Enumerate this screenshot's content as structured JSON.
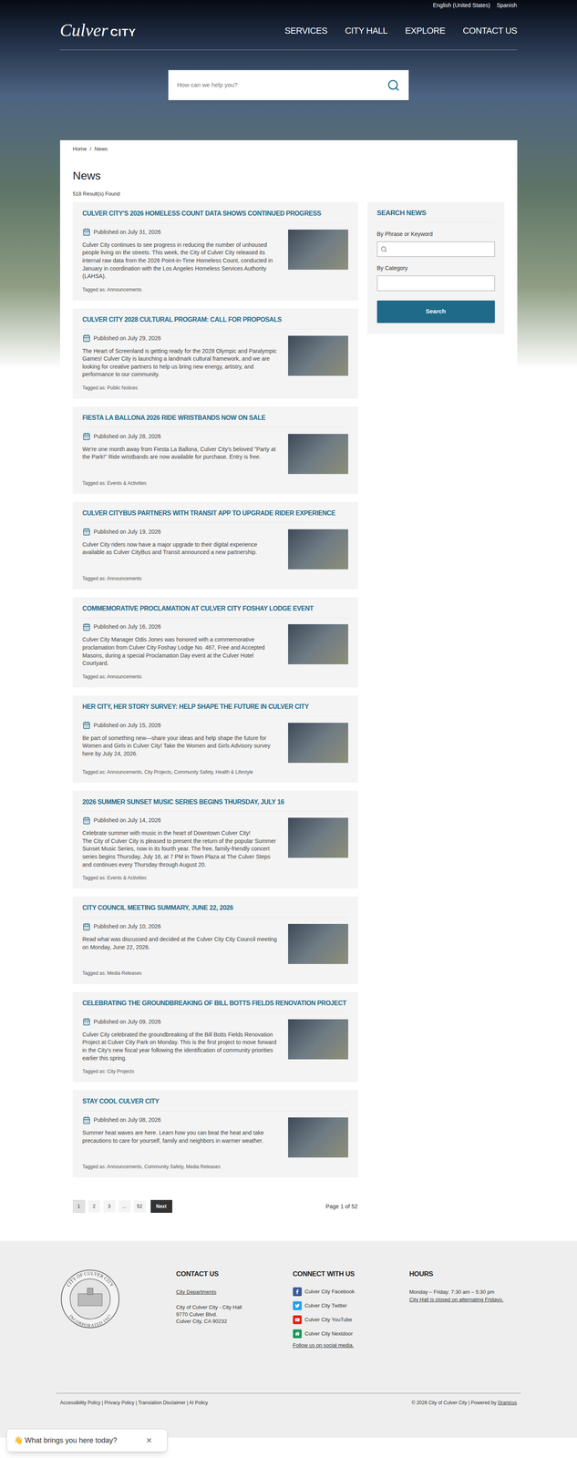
{
  "language_bar": [
    "English (United States)",
    "Spanish"
  ],
  "logo": {
    "script": "Culver",
    "bold": "CITY"
  },
  "nav": [
    "SERVICES",
    "CITY HALL",
    "EXPLORE",
    "CONTACT US"
  ],
  "site_search": {
    "placeholder": "How can we help you?"
  },
  "breadcrumb": [
    "Home",
    "/",
    "News"
  ],
  "page_title": "News",
  "result_count": "518 Result(s) Found",
  "news": [
    {
      "title": "CULVER CITY'S 2026 HOMELESS COUNT DATA SHOWS CONTINUED PROGRESS",
      "published": "Published on July 31, 2026",
      "description": "Culver City continues to see progress in reducing the number of unhoused people living on the streets. This week, the City of Culver City released its internal raw data from the 2026 Point-in-Time Homeless Count, conducted in January in coordination with the Los Angeles Homeless Services Authority (LAHSA).",
      "tags": "Tagged as: Announcements"
    },
    {
      "title": "CULVER CITY 2028 CULTURAL PROGRAM: CALL FOR PROPOSALS",
      "published": "Published on July 29, 2026",
      "description": "The Heart of Screenland is getting ready for the 2028 Olympic and Paralympic Games! Culver City is launching a landmark cultural framework, and we are looking for creative partners to help us bring new energy, artistry, and performance to our community.",
      "tags": "Tagged as: Public Notices"
    },
    {
      "title": "FIESTA LA BALLONA 2026 RIDE WRISTBANDS NOW ON SALE",
      "published": "Published on July 28, 2026",
      "description": "We're one month away from Fiesta La Ballona, Culver City's beloved \"Party at the Park!\" Ride wristbands are now available for purchase. Entry is free.",
      "tags": "Tagged as: Events & Activities"
    },
    {
      "title": "CULVER CITYBUS PARTNERS WITH TRANSIT APP TO UPGRADE RIDER EXPERIENCE",
      "published": "Published on July 19, 2026",
      "description": "Culver City riders now have a major upgrade to their digital experience available as Culver CityBus and Transit announced a new partnership.",
      "tags": "Tagged as: Announcements"
    },
    {
      "title": "COMMEMORATIVE PROCLAMATION AT CULVER CITY FOSHAY LODGE EVENT",
      "published": "Published on July 16, 2026",
      "description": "Culver City Manager Odis Jones was honored with a commemorative proclamation from Culver City Foshay Lodge No. 467, Free and Accepted Masons, during a special Proclamation Day event at the Culver Hotel Courtyard.",
      "tags": "Tagged as: Announcements"
    },
    {
      "title": "HER CITY, HER STORY SURVEY: HELP SHAPE THE FUTURE IN CULVER CITY",
      "published": "Published on July 15, 2026",
      "description": "Be part of something new—share your ideas and help shape the future for Women and Girls in Culver City! Take the Women and Girls Advisory survey here by July 24, 2026.",
      "tags": "Tagged as: Announcements, City Projects, Community Safety, Health & Lifestyle"
    },
    {
      "title": "2026 SUMMER SUNSET MUSIC SERIES BEGINS THURSDAY, JULY 16",
      "published": "Published on July 14, 2026",
      "description": "Celebrate summer with music in the heart of Downtown Culver City!\nThe City of Culver City is pleased to present the return of the popular Summer Sunset Music Series, now in its fourth year. The free, family-friendly concert series begins Thursday, July 16, at 7 PM in Town Plaza at The Culver Steps and continues every Thursday through August 20.",
      "tags": "Tagged as: Events & Activities"
    },
    {
      "title": "CITY COUNCIL MEETING SUMMARY, JUNE 22, 2026",
      "published": "Published on July 10, 2026",
      "description": "Read what was discussed and decided at the Culver City City Council meeting on Monday, June 22, 2026.",
      "tags": "Tagged as: Media Releases"
    },
    {
      "title": "CELEBRATING THE GROUNDBREAKING OF BILL BOTTS FIELDS RENOVATION PROJECT",
      "published": "Published on July 09, 2026",
      "description": "Culver City celebrated the groundbreaking of the Bill Botts Fields Renovation Project at Culver City Park on Monday. This is the first project to move forward in the City's new fiscal year following the identification of community priorities earlier this spring.",
      "tags": "Tagged as: City Projects"
    },
    {
      "title": "STAY COOL CULVER CITY",
      "published": "Published on July 08, 2026",
      "description": "Summer heat waves are here. Learn how you can beat the heat and take precautions to care for yourself, family and neighbors in warmer weather.",
      "tags": "Tagged as: Announcements, Community Safety, Media Releases"
    }
  ],
  "pagination": {
    "pages": [
      {
        "label": "1",
        "selected": true
      },
      {
        "label": "2",
        "selected": false
      },
      {
        "label": "3",
        "selected": false
      },
      {
        "label": "...",
        "selected": false
      },
      {
        "label": "52",
        "selected": false
      }
    ],
    "next": "Next",
    "status": "Page 1 of 52"
  },
  "sidebar": {
    "title": "SEARCH NEWS",
    "keyword_label": "By Phrase or Keyword",
    "category_label": "By Category",
    "button": "Search"
  },
  "footer": {
    "seal": {
      "top": "CITY OF CULVER CITY",
      "bottom": "INCORPORATED 1917"
    },
    "contact": {
      "title": "CONTACT US",
      "link": "City Departments",
      "lines": [
        "City of Culver City - City Hall",
        "9770 Culver Blvd.",
        "Culver City, CA 90232"
      ]
    },
    "connect": {
      "title": "CONNECT WITH US",
      "items": [
        {
          "label": "Culver City Facebook",
          "kind": "facebook",
          "color": "#3b5998"
        },
        {
          "label": "Culver City Twitter",
          "kind": "twitter",
          "color": "#1da1f2"
        },
        {
          "label": "Culver City YouTube",
          "kind": "youtube",
          "color": "#e62117"
        },
        {
          "label": "Culver City Nextdoor",
          "kind": "nextdoor",
          "color": "#19975d"
        }
      ],
      "follow": "Follow us on social media."
    },
    "hours": {
      "title": "HOURS",
      "line": "Monday – Friday: 7:30 am – 5:30 pm",
      "note": "City Hall is closed on alternating Fridays."
    },
    "policies": "Accessibility Policy | Privacy Policy | Translation Disclaimer | AI Policy",
    "copyright": "© 2026 City of Culver City | Powered by ",
    "powered": "Granicus"
  },
  "chat": {
    "text": "👋 What brings you here today?",
    "close": "×"
  }
}
